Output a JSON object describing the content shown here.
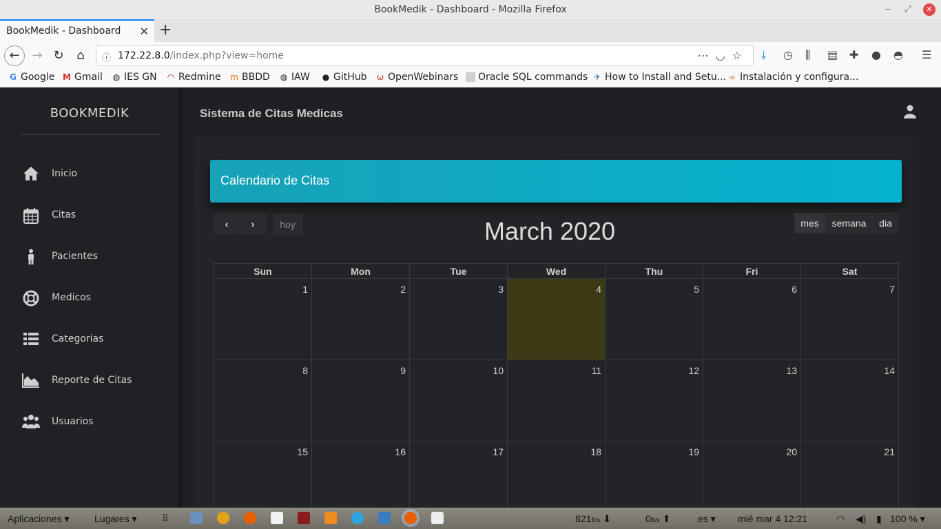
{
  "browser": {
    "window_title": "BookMedik - Dashboard - Mozilla Firefox",
    "tab_title": "BookMedik - Dashboard",
    "url_host": "172.22.8.0",
    "url_path": "/index.php?view=home",
    "bookmarks": [
      {
        "label": "Google",
        "icon": "google-icon"
      },
      {
        "label": "Gmail",
        "icon": "gmail-icon"
      },
      {
        "label": "IES GN",
        "icon": "globe-icon"
      },
      {
        "label": "Redmine",
        "icon": "redmine-icon"
      },
      {
        "label": "BBDD",
        "icon": "bbdd-icon"
      },
      {
        "label": "IAW",
        "icon": "globe-icon"
      },
      {
        "label": "GitHub",
        "icon": "github-icon"
      },
      {
        "label": "OpenWebinars",
        "icon": "openwebinars-icon"
      },
      {
        "label": "Oracle SQL commands",
        "icon": "page-icon"
      },
      {
        "label": "How to Install and Setu...",
        "icon": "bird-icon"
      },
      {
        "label": "Instalación y configura...",
        "icon": "link-icon"
      }
    ]
  },
  "sidebar": {
    "brand": "BOOKMEDIK",
    "items": [
      {
        "label": "Inicio",
        "icon": "home-icon"
      },
      {
        "label": "Citas",
        "icon": "calendar-icon"
      },
      {
        "label": "Pacientes",
        "icon": "person-icon"
      },
      {
        "label": "Medicos",
        "icon": "lifebuoy-icon"
      },
      {
        "label": "Categorias",
        "icon": "list-icon"
      },
      {
        "label": "Reporte de Citas",
        "icon": "area-chart-icon"
      },
      {
        "label": "Usuarios",
        "icon": "users-icon"
      }
    ]
  },
  "header": {
    "title": "Sistema de Citas Medicas"
  },
  "calendar": {
    "card_title": "Calendario de Citas",
    "prev": "‹",
    "next": "›",
    "today_label": "hoy",
    "month_title": "March 2020",
    "views": [
      "mes",
      "semana",
      "dia"
    ],
    "active_view": "mes",
    "weekdays": [
      "Sun",
      "Mon",
      "Tue",
      "Wed",
      "Thu",
      "Fri",
      "Sat"
    ],
    "weeks": [
      [
        "1",
        "2",
        "3",
        "4",
        "5",
        "6",
        "7"
      ],
      [
        "8",
        "9",
        "10",
        "11",
        "12",
        "13",
        "14"
      ],
      [
        "15",
        "16",
        "17",
        "18",
        "19",
        "20",
        "21"
      ]
    ],
    "today": "4",
    "today_color": "#3d3a15"
  },
  "taskbar": {
    "apps_menu": "Aplicaciones ▾",
    "places_menu": "Lugares ▾",
    "net_down": "821",
    "net_down_unit": "B/s",
    "net_up": "0",
    "net_up_unit": "B/s",
    "lang": "es ▾",
    "clock": "mié mar 4  12:21",
    "battery": "100 % ▾"
  },
  "colors": {
    "header_accent": "#05b3cf",
    "today_highlight": "#3d3a15"
  }
}
